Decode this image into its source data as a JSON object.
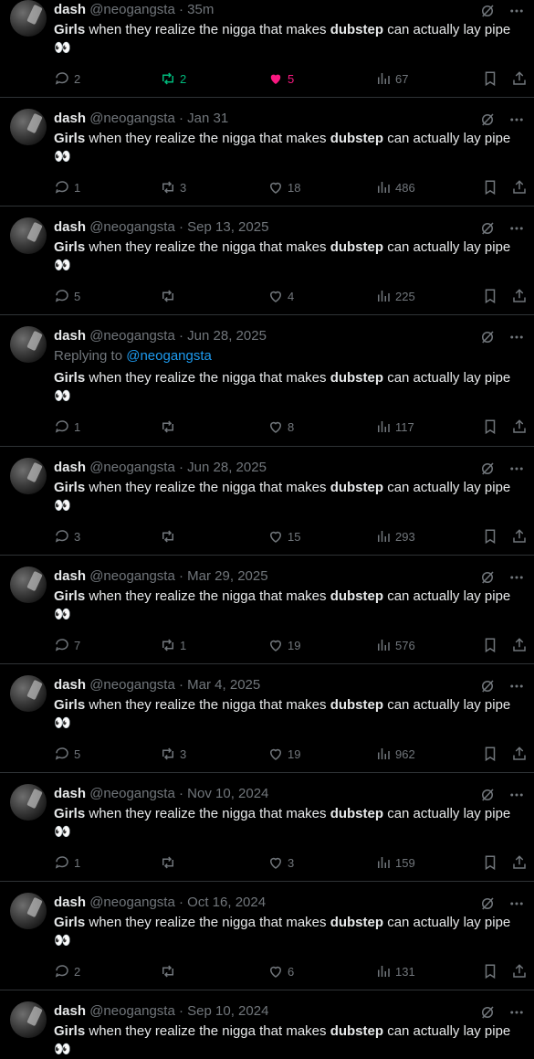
{
  "colors": {
    "background": "#000000",
    "text": "#e7e9ea",
    "muted": "#71767b",
    "link": "#1d9bf0",
    "retweet_active": "#00ba7c",
    "like_active": "#f91880",
    "divider": "#2f3336"
  },
  "author": {
    "name": "dash",
    "handle": "@neogangsta"
  },
  "tweet_text": {
    "bold1": "Girls",
    "middle": " when they realize the nigga that makes ",
    "bold2": "dubstep",
    "end": " can actually lay pipe",
    "emoji": "👀"
  },
  "tweets": [
    {
      "dot": "·",
      "time": "35m",
      "replies": "2",
      "retweets": "2",
      "likes": "5",
      "views": "67",
      "retweeted": true,
      "liked": true
    },
    {
      "dot": "·",
      "time": "Jan 31",
      "replies": "1",
      "retweets": "3",
      "likes": "18",
      "views": "486"
    },
    {
      "dot": "·",
      "time": "Sep 13, 2025",
      "replies": "5",
      "retweets": "",
      "likes": "4",
      "views": "225"
    },
    {
      "dot": "·",
      "time": "Jun 28, 2025",
      "replying_label": "Replying to",
      "replying_handle": "@neogangsta",
      "replies": "1",
      "retweets": "",
      "likes": "8",
      "views": "117"
    },
    {
      "dot": "·",
      "time": "Jun 28, 2025",
      "replies": "3",
      "retweets": "",
      "likes": "15",
      "views": "293"
    },
    {
      "dot": "·",
      "time": "Mar 29, 2025",
      "replies": "7",
      "retweets": "1",
      "likes": "19",
      "views": "576"
    },
    {
      "dot": "·",
      "time": "Mar 4, 2025",
      "replies": "5",
      "retweets": "3",
      "likes": "19",
      "views": "962"
    },
    {
      "dot": "·",
      "time": "Nov 10, 2024",
      "replies": "1",
      "retweets": "",
      "likes": "3",
      "views": "159"
    },
    {
      "dot": "·",
      "time": "Oct 16, 2024",
      "replies": "2",
      "retweets": "",
      "likes": "6",
      "views": "131"
    },
    {
      "dot": "·",
      "time": "Sep 10, 2024"
    }
  ],
  "icons": {
    "reply": "reply-icon",
    "retweet": "retweet-icon",
    "like": "heart-icon",
    "views": "views-icon",
    "bookmark": "bookmark-icon",
    "share": "share-icon",
    "grok": "grok-icon",
    "more": "more-icon"
  }
}
